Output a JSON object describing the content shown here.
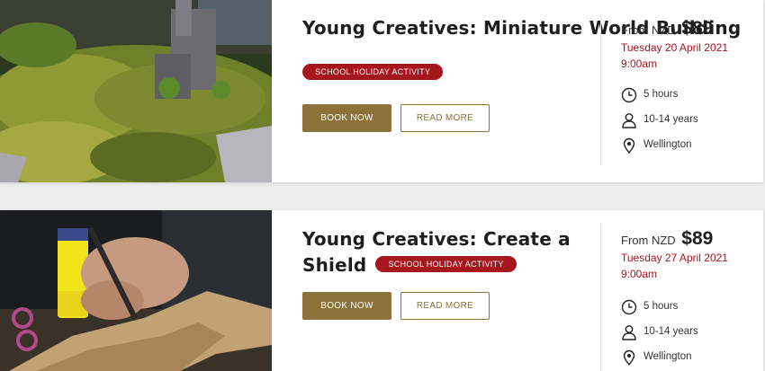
{
  "events": [
    {
      "title": "Young Creatives: Miniature World Building",
      "badge": "SCHOOL HOLIDAY ACTIVITY",
      "book_label": "BOOK NOW",
      "more_label": "READ MORE",
      "price_prefix": "From NZD",
      "price": "$89",
      "date": "Tuesday 20 April 2021",
      "time": "9:00am",
      "duration": "5 hours",
      "age": "10-14 years",
      "location": "Wellington",
      "image_icon": "miniature-landscape-photo"
    },
    {
      "title": "Young Creatives: Create a Shield",
      "badge": "SCHOOL HOLIDAY ACTIVITY",
      "book_label": "BOOK NOW",
      "more_label": "READ MORE",
      "price_prefix": "From NZD",
      "price": "$89",
      "date": "Tuesday 27 April 2021",
      "time": "9:00am",
      "duration": "5 hours",
      "age": "10-14 years",
      "location": "Wellington",
      "image_icon": "cardboard-shield-craft-photo"
    }
  ],
  "colors": {
    "badge": "#a5161d",
    "button": "#8c7138",
    "date": "#a5161d"
  },
  "icons": {
    "duration": "clock-icon",
    "age": "person-icon",
    "location": "map-pin-icon"
  }
}
